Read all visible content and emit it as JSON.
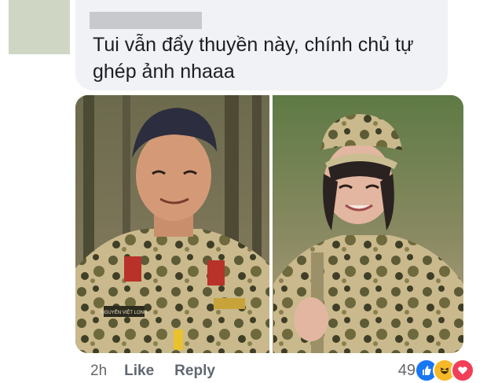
{
  "comment": {
    "author_redacted": "",
    "text": "Tui vẫn đẩy thuyền này, chính chủ tự ghép ảnh nhaaa"
  },
  "photo": {
    "left_name_tag": "NGUYỄN VIỆT LONG",
    "description_icon": "photo-collage"
  },
  "actions": {
    "time": "2h",
    "like_label": "Like",
    "reply_label": "Reply"
  },
  "reactions": {
    "count": "49",
    "types": [
      "like-icon",
      "haha-icon",
      "love-icon"
    ],
    "colors": {
      "like": "#1877f2",
      "haha": "#f7b928",
      "love": "#f33e58"
    }
  }
}
